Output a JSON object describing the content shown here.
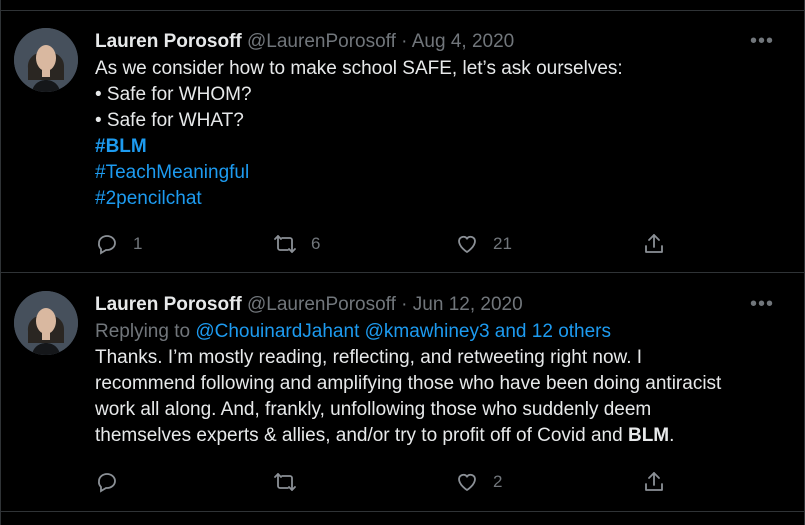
{
  "tweets": [
    {
      "name": "Lauren Porosoff",
      "handle": "@LaurenPorosoff",
      "separator": "·",
      "date": "Aug 4, 2020",
      "lines": [
        "As we consider how to make school SAFE, let’s ask ourselves:",
        "• Safe for WHOM?",
        "• Safe for WHAT?"
      ],
      "hashtags": [
        "#BLM",
        "#TeachMeaningful",
        "#2pencilchat"
      ],
      "replies": "1",
      "retweets": "6",
      "likes": "21",
      "more_icon": "more-horizontal-icon"
    },
    {
      "name": "Lauren Porosoff",
      "handle": "@LaurenPorosoff",
      "separator": "·",
      "date": "Jun 12, 2020",
      "replying_prefix": "Replying to",
      "replying_to": "@ChouinardJahant @kmawhiney3 and 12 others",
      "lines": [
        "Thanks. I’m mostly reading, reflecting, and retweeting right now. I",
        "recommend following and amplifying those who have been doing antiracist",
        "work all along. And, frankly, unfollowing those who suddenly deem",
        "themselves experts & allies, and/or try to profit off of Covid and "
      ],
      "last_bold": "BLM",
      "last_suffix": ".",
      "replies": "",
      "retweets": "",
      "likes": "2",
      "more_icon": "more-horizontal-icon"
    }
  ],
  "colors": {
    "background": "#000000",
    "text": "#e7e9ea",
    "muted": "#71767b",
    "link": "#1d9bf0",
    "divider": "#2f3336"
  },
  "icons": {
    "reply": "reply-icon",
    "retweet": "retweet-icon",
    "like": "heart-icon",
    "share": "share-icon"
  }
}
